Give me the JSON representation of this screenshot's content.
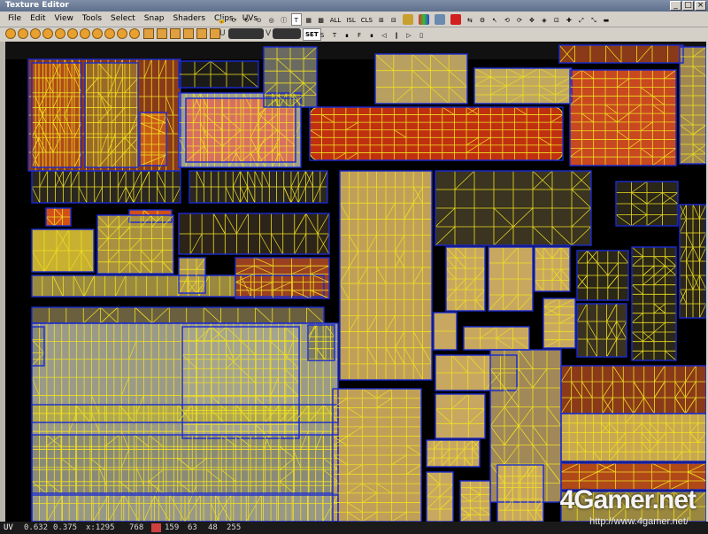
{
  "window": {
    "title": "Texture Editor"
  },
  "menu": [
    "File",
    "Edit",
    "View",
    "Tools",
    "Select",
    "Snap",
    "Shaders",
    "Clips",
    "UVs"
  ],
  "toolbar1": {
    "text_buttons": [
      "T",
      "ALL",
      "ISL",
      "CLS"
    ]
  },
  "toolbar2": {
    "u_label": "U",
    "v_label": "V",
    "set_label": "SET",
    "right_glyphs": [
      "S",
      "T",
      "∎",
      "F",
      "∎",
      "◁",
      "‖",
      "▷",
      "▯"
    ]
  },
  "status": {
    "label": "UV",
    "u": "0.632",
    "v": "0.375",
    "px_x": "x:1295",
    "px_y": "768",
    "r": "159",
    "g": "63",
    "b": "48",
    "a": "255",
    "swatch_color": "#d04040"
  },
  "watermark": {
    "logo": "4Gamer.net",
    "url": "http://www.4gamer.net/"
  },
  "colors": {
    "island_fill_tan": "#c0a050",
    "island_fill_gray": "#9a9a88",
    "island_fill_red": "#c84a18",
    "wire": "#f0e020",
    "edge": "#1a2ad0"
  }
}
